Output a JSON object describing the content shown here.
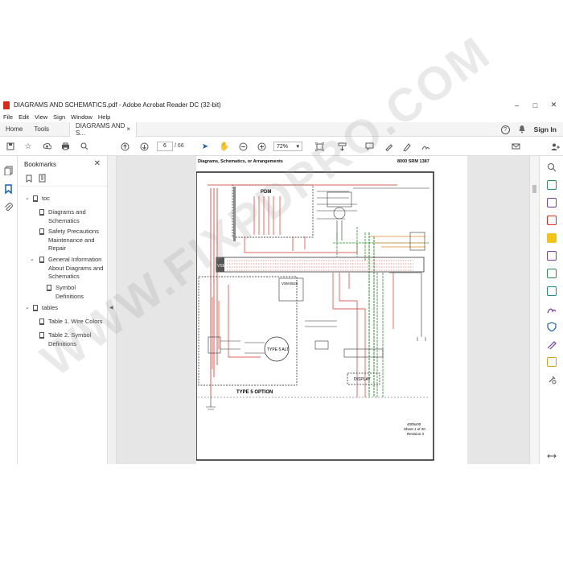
{
  "window": {
    "title": "DIAGRAMS AND SCHEMATICS.pdf - Adobe Acrobat Reader DC (32-bit)",
    "minimize": "–",
    "maximize": "□",
    "close": "✕"
  },
  "menu": [
    "File",
    "Edit",
    "View",
    "Sign",
    "Window",
    "Help"
  ],
  "tabs": {
    "home": "Home",
    "tools": "Tools",
    "document": "DIAGRAMS AND S...",
    "document_close": "×",
    "help_icon": "?",
    "sign_in": "Sign In"
  },
  "toolbar": {
    "page_current": "6",
    "page_total": "/ 66",
    "zoom": "72%",
    "icons": [
      "save-icon",
      "star-icon",
      "upload-icon",
      "print-icon",
      "search-icon",
      "prev-page-icon",
      "next-page-icon",
      "cursor-icon",
      "hand-icon",
      "zoom-out-icon",
      "zoom-in-icon",
      "fit-page-icon",
      "scroll-mode-icon",
      "comment-icon",
      "highlight-icon",
      "draw-icon",
      "sign-icon",
      "email-icon",
      "share-icon"
    ]
  },
  "panel": {
    "title": "Bookmarks",
    "bookmarks": [
      {
        "label": "toc",
        "level": 0,
        "expanded": true
      },
      {
        "label": "Diagrams and Schematics",
        "level": 1
      },
      {
        "label": "Safety Precautions Maintenance and Repair",
        "level": 1
      },
      {
        "label": "General Information About Diagrams and Schematics",
        "level": 1,
        "expanded": true
      },
      {
        "label": "Symbol Definitions",
        "level": 2
      },
      {
        "label": "tables",
        "level": 0,
        "expanded": true
      },
      {
        "label": "Table 1. Wire Colors",
        "level": 1
      },
      {
        "label": "Table 2. Symbol Definitions",
        "level": 1
      }
    ]
  },
  "pdf_page": {
    "header_left": "Diagrams, Schematics, or Arrangements",
    "header_right": "8000 SRM 1387",
    "labels": {
      "pdm": "PDM",
      "vsm": "VSM",
      "vsm_bus": "VSM BUS",
      "type5_alt": "TYPE 5 ALT",
      "type5_option": "TYPE 5 OPTION",
      "display": "DISPLAY",
      "figure_id": "4005x00",
      "sheet": "Sheet 1 of 20",
      "revision": "Revision 3"
    }
  },
  "watermark": "WWW.FIXPDPRO.COM",
  "colors": {
    "accent_red": "#d52b1e",
    "wire_red": "#d0342c",
    "wire_green": "#2e8b2e",
    "wire_orange": "#e08a2b",
    "wire_dark": "#333333"
  }
}
